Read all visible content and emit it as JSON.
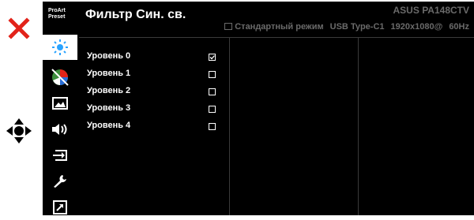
{
  "osd": {
    "title": "Фильтр Син. св.",
    "model": "ASUS PA148CTV",
    "status": {
      "mode": "Стандартный режим",
      "input": "USB Type-C1",
      "resolution": "1920x1080@",
      "refresh": "60Hz"
    },
    "brand_badge": {
      "line1": "ProArt",
      "line2": "Preset"
    },
    "sidebar": [
      {
        "icon": "blue-light-icon",
        "active": true
      },
      {
        "icon": "color-icon",
        "active": false
      },
      {
        "icon": "image-icon",
        "active": false
      },
      {
        "icon": "sound-icon",
        "active": false
      },
      {
        "icon": "input-select-icon",
        "active": false
      },
      {
        "icon": "system-setup-icon",
        "active": false
      },
      {
        "icon": "shortcut-icon",
        "active": false
      }
    ],
    "levels": [
      {
        "label": "Уровень 0",
        "checked": true
      },
      {
        "label": "Уровень 1",
        "checked": false
      },
      {
        "label": "Уровень 2",
        "checked": false
      },
      {
        "label": "Уровень 3",
        "checked": false
      },
      {
        "label": "Уровень 4",
        "checked": false
      }
    ]
  },
  "controls": {
    "close_icon": "close-icon",
    "navigate_icon": "navigation-icon"
  },
  "colors": {
    "accent": "#e2231a",
    "panel": "#000000",
    "muted_text": "#6a6a6a"
  }
}
